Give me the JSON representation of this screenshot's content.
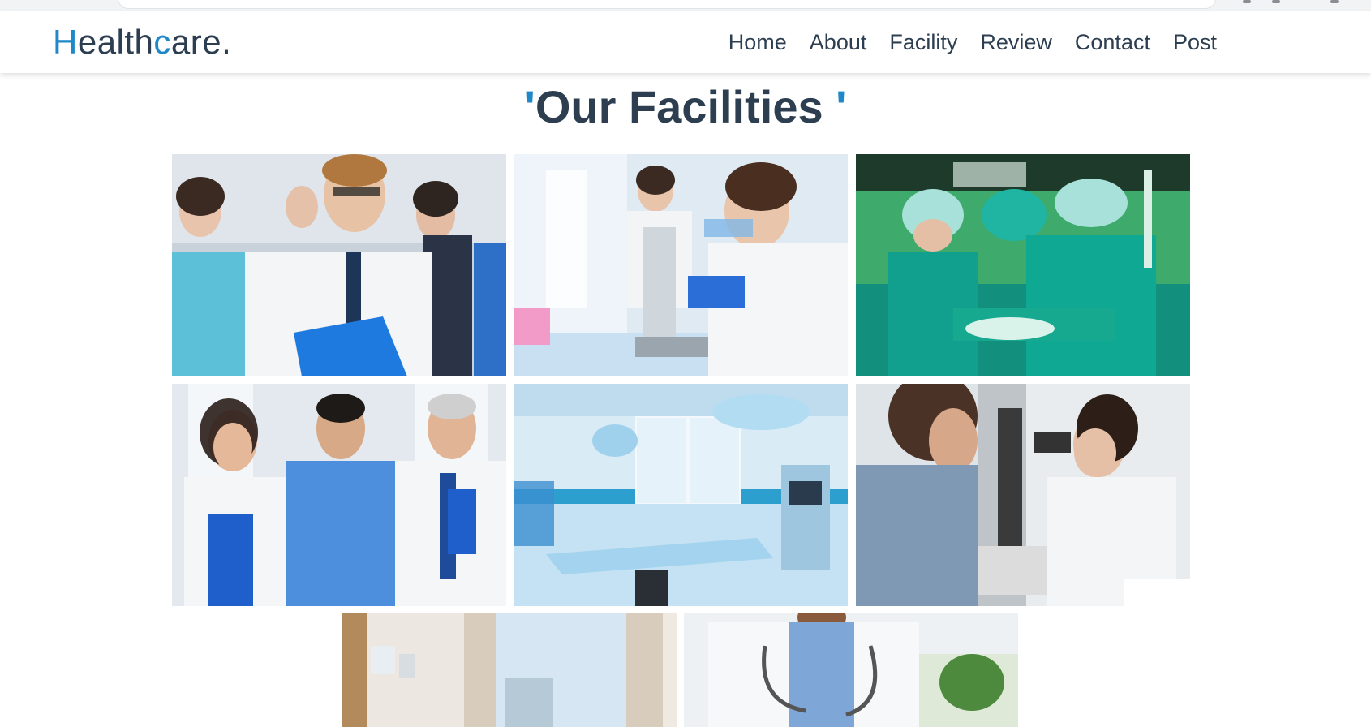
{
  "brand": {
    "first_letter": "H",
    "part_one": "ealth",
    "accent_letter": "c",
    "part_two": "are."
  },
  "nav": {
    "items": [
      "Home",
      "About",
      "Facility",
      "Review",
      "Contact",
      "Post"
    ]
  },
  "section": {
    "quote_open": "'",
    "heading": "Our Facilities ",
    "quote_close": "'"
  },
  "colors": {
    "accent": "#1e88c9",
    "text": "#2c3e50"
  },
  "gallery": {
    "images": [
      "doctor-team-photo",
      "lab-microscope-photo",
      "surgery-team-photo",
      "three-doctors-photo",
      "operating-room-photo",
      "eye-exam-photo",
      "hospital-room-photo",
      "doctor-stethoscope-photo"
    ]
  }
}
